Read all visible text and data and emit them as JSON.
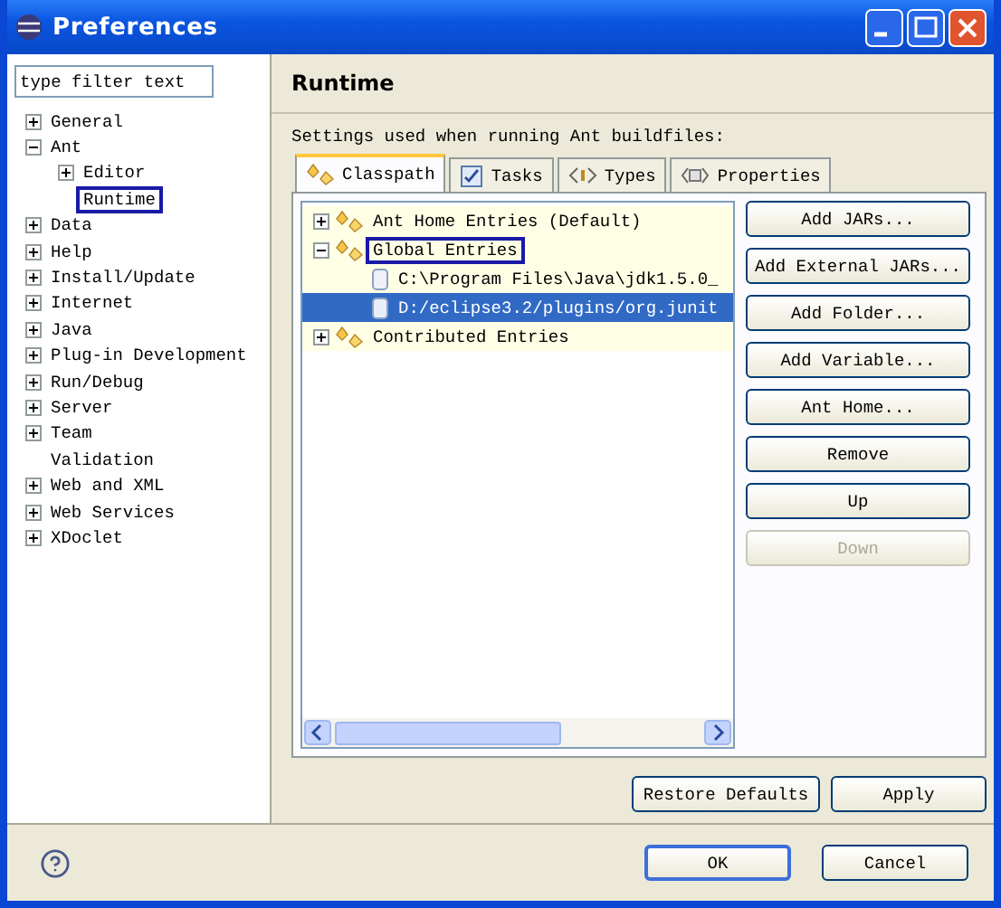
{
  "window": {
    "title": "Preferences"
  },
  "filter": {
    "placeholder": "type filter text"
  },
  "nav_tree": [
    {
      "label": "General",
      "kind": "folder",
      "expanded": false,
      "outlined": false
    },
    {
      "label": "Ant",
      "kind": "folder",
      "expanded": true,
      "outlined": false,
      "children": [
        {
          "label": "Editor",
          "kind": "folder",
          "expanded": false,
          "outlined": false
        },
        {
          "label": "Runtime",
          "kind": "page",
          "outlined": true
        }
      ]
    },
    {
      "label": "Data",
      "kind": "folder",
      "expanded": false,
      "outlined": false
    },
    {
      "label": "Help",
      "kind": "folder",
      "expanded": false,
      "outlined": false
    },
    {
      "label": "Install/Update",
      "kind": "folder",
      "expanded": false,
      "outlined": false
    },
    {
      "label": "Internet",
      "kind": "folder",
      "expanded": false,
      "outlined": false
    },
    {
      "label": "Java",
      "kind": "folder",
      "expanded": false,
      "outlined": false
    },
    {
      "label": "Plug-in Development",
      "kind": "folder",
      "expanded": false,
      "outlined": false
    },
    {
      "label": "Run/Debug",
      "kind": "folder",
      "expanded": false,
      "outlined": false
    },
    {
      "label": "Server",
      "kind": "folder",
      "expanded": false,
      "outlined": false
    },
    {
      "label": "Team",
      "kind": "folder",
      "expanded": false,
      "outlined": false
    },
    {
      "label": "Validation",
      "kind": "page",
      "outlined": false
    },
    {
      "label": "Web and XML",
      "kind": "folder",
      "expanded": false,
      "outlined": false
    },
    {
      "label": "Web Services",
      "kind": "folder",
      "expanded": false,
      "outlined": false
    },
    {
      "label": "XDoclet",
      "kind": "folder",
      "expanded": false,
      "outlined": false
    }
  ],
  "page": {
    "title": "Runtime",
    "description": "Settings used when running Ant buildfiles:"
  },
  "tabs": [
    {
      "label": "Classpath",
      "selected": true
    },
    {
      "label": "Tasks",
      "selected": false
    },
    {
      "label": "Types",
      "selected": false
    },
    {
      "label": "Properties",
      "selected": false
    }
  ],
  "classpath_tree": [
    {
      "label": "Ant Home Entries (Default)",
      "kind": "group",
      "expanded": false,
      "outlined": false,
      "selected": false
    },
    {
      "label": "Global Entries",
      "kind": "group",
      "expanded": true,
      "outlined": true,
      "selected": false,
      "children": [
        {
          "label": "C:\\Program Files\\Java\\jdk1.5.0_",
          "kind": "jar",
          "outlined": false,
          "selected": false
        },
        {
          "label": "D:/eclipse3.2/plugins/org.junit",
          "kind": "jar",
          "outlined": false,
          "selected": true
        }
      ]
    },
    {
      "label": "Contributed Entries",
      "kind": "group",
      "expanded": false,
      "outlined": false,
      "selected": false
    }
  ],
  "side_buttons": [
    {
      "label": "Add JARs...",
      "disabled": false
    },
    {
      "label": "Add External JARs...",
      "disabled": false
    },
    {
      "label": "Add Folder...",
      "disabled": false
    },
    {
      "label": "Add Variable...",
      "disabled": false
    },
    {
      "label": "Ant Home...",
      "disabled": false
    },
    {
      "label": "Remove",
      "disabled": false
    },
    {
      "label": "Up",
      "disabled": false
    },
    {
      "label": "Down",
      "disabled": true
    }
  ],
  "page_buttons": [
    "Restore Defaults",
    "Apply"
  ],
  "dialog_buttons": [
    {
      "label": "OK",
      "default": true
    },
    {
      "label": "Cancel",
      "default": false
    }
  ]
}
